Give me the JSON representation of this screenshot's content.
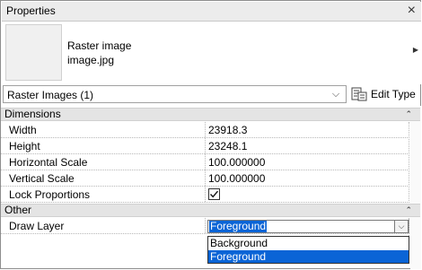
{
  "panel": {
    "title": "Properties",
    "close_glyph": "×"
  },
  "preview": {
    "type_name": "Raster image",
    "file_name": "image.jpg",
    "scroll_glyph": "▶"
  },
  "type_selector": {
    "value": "Raster Images (1)",
    "chevron_glyph": "⌵",
    "edit_type_label": "Edit Type"
  },
  "groups": {
    "dimensions": {
      "label": "Dimensions",
      "collapse_glyph": "⌃",
      "rows": [
        {
          "name": "Width",
          "value": "23918.3"
        },
        {
          "name": "Height",
          "value": "23248.1"
        },
        {
          "name": "Horizontal Scale",
          "value": "100.000000"
        },
        {
          "name": "Vertical Scale",
          "value": "100.000000"
        },
        {
          "name": "Lock Proportions",
          "value": "",
          "checked": true
        }
      ]
    },
    "other": {
      "label": "Other",
      "collapse_glyph": "⌃",
      "rows": [
        {
          "name": "Draw Layer",
          "value": "Foreground"
        }
      ]
    }
  },
  "draw_layer_dropdown": {
    "button_glyph": "⌵",
    "options": [
      "Background",
      "Foreground"
    ],
    "selected": "Foreground"
  },
  "colors": {
    "selection": "#0a64d6",
    "group_header": "#e4e4e4",
    "title_bar": "#ececec"
  }
}
